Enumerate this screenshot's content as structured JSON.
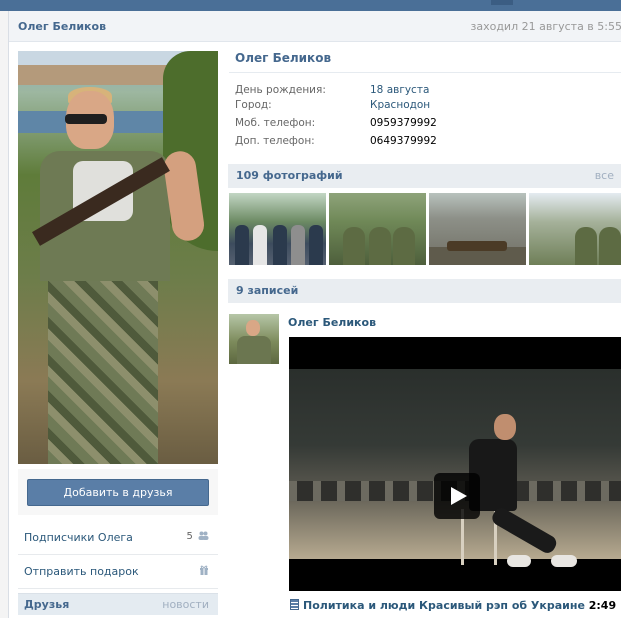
{
  "header": {
    "name": "Олег Беликов",
    "last_seen": "заходил 21 августа в 5:55"
  },
  "sidebar": {
    "add_friend_label": "Добавить в друзья",
    "links": [
      {
        "label": "Подписчики Олега",
        "count": "5",
        "icon": "people-icon"
      },
      {
        "label": "Отправить подарок",
        "count": "",
        "icon": "gift-icon"
      }
    ],
    "friends_title": "Друзья",
    "friends_action": "новости"
  },
  "profile": {
    "name": "Олег Беликов",
    "fields": [
      {
        "key": "День рождения:",
        "value": "18 августа",
        "is_link": true
      },
      {
        "key": "Город:",
        "value": "Краснодон",
        "is_link": true
      },
      {
        "key": "Моб. телефон:",
        "value": "0959379992",
        "is_link": false
      },
      {
        "key": "Доп. телефон:",
        "value": "0649379992",
        "is_link": false
      }
    ]
  },
  "photos": {
    "title": "109 фотографий",
    "all_label": "все"
  },
  "wall": {
    "title": "9 записей",
    "post": {
      "author": "Олег Беликов",
      "video_title": "Политика и люди Красивый рэп об Украине",
      "video_duration": "2:49"
    }
  },
  "colors": {
    "link": "#2b587a",
    "header_text": "#45688e",
    "button": "#5a7ea7",
    "section_bg": "#e9edf1"
  }
}
